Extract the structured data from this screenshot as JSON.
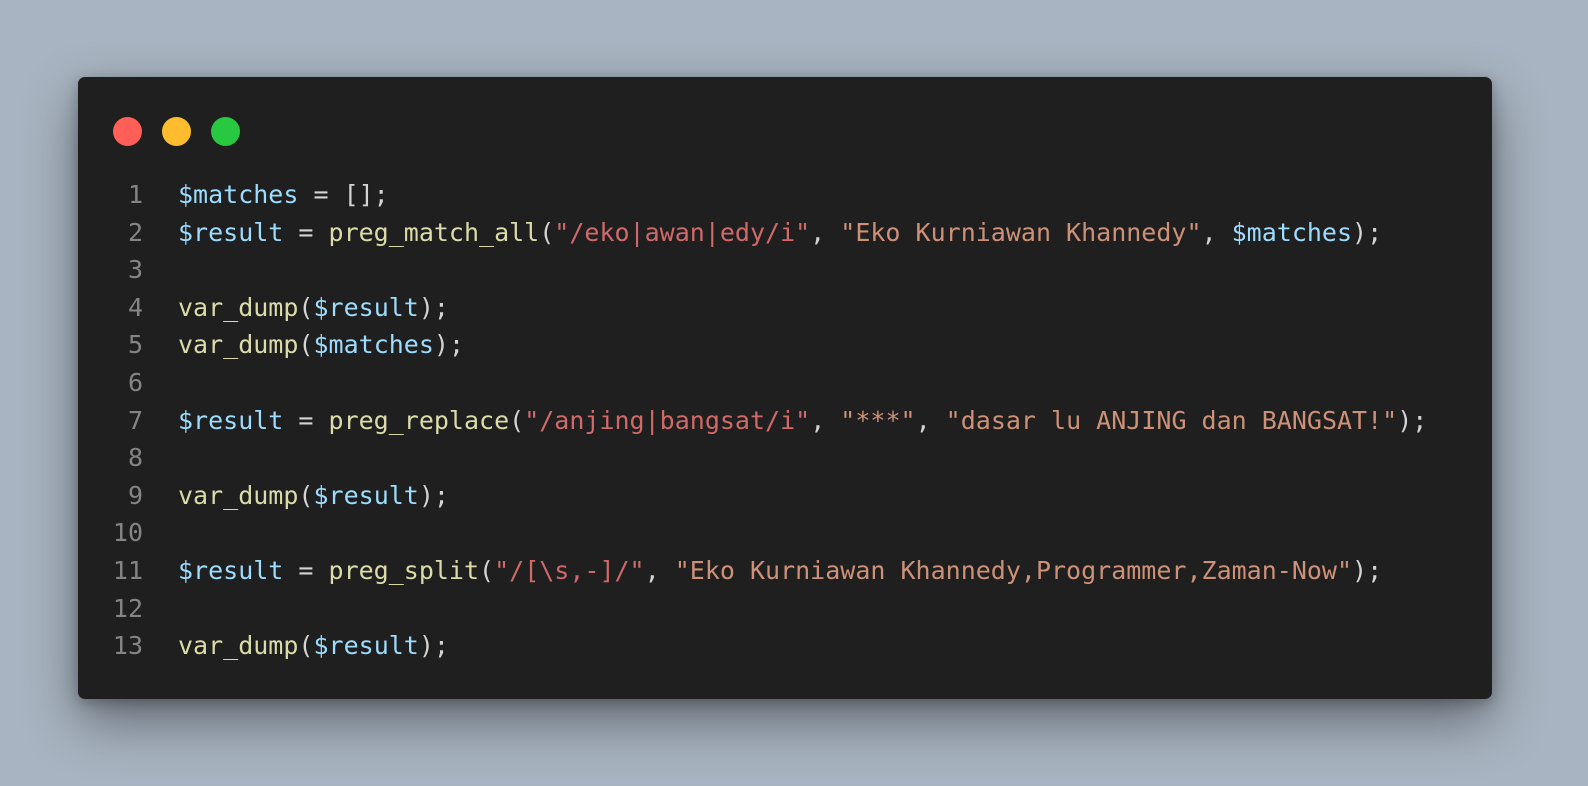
{
  "colors": {
    "background": "#a8b4c1",
    "window": "#1f1f1f",
    "traffic_red": "#ff5f57",
    "traffic_yellow": "#febc2e",
    "traffic_green": "#28c840",
    "line_number": "#858585",
    "variable": "#9cdcfe",
    "function": "#dcdcaa",
    "string": "#ce9178",
    "regex": "#d16969",
    "punctuation": "#d4d4d4"
  },
  "window_controls": [
    {
      "icon": "close-dot-icon",
      "color": "#ff5f57"
    },
    {
      "icon": "minimize-dot-icon",
      "color": "#febc2e"
    },
    {
      "icon": "maximize-dot-icon",
      "color": "#28c840"
    }
  ],
  "lines": [
    {
      "n": "1",
      "tokens": [
        {
          "t": "$matches",
          "c": "#9cdcfe"
        },
        {
          "t": " = [];",
          "c": "#d4d4d4"
        }
      ]
    },
    {
      "n": "2",
      "tokens": [
        {
          "t": "$result",
          "c": "#9cdcfe"
        },
        {
          "t": " = ",
          "c": "#d4d4d4"
        },
        {
          "t": "preg_match_all",
          "c": "#dcdcaa"
        },
        {
          "t": "(",
          "c": "#d4d4d4"
        },
        {
          "t": "\"/eko|awan|edy/i\"",
          "c": "#d16969"
        },
        {
          "t": ", ",
          "c": "#d4d4d4"
        },
        {
          "t": "\"Eko Kurniawan Khannedy\"",
          "c": "#ce9178"
        },
        {
          "t": ", ",
          "c": "#d4d4d4"
        },
        {
          "t": "$matches",
          "c": "#9cdcfe"
        },
        {
          "t": ");",
          "c": "#d4d4d4"
        }
      ]
    },
    {
      "n": "3",
      "tokens": []
    },
    {
      "n": "4",
      "tokens": [
        {
          "t": "var_dump",
          "c": "#dcdcaa"
        },
        {
          "t": "(",
          "c": "#d4d4d4"
        },
        {
          "t": "$result",
          "c": "#9cdcfe"
        },
        {
          "t": ");",
          "c": "#d4d4d4"
        }
      ]
    },
    {
      "n": "5",
      "tokens": [
        {
          "t": "var_dump",
          "c": "#dcdcaa"
        },
        {
          "t": "(",
          "c": "#d4d4d4"
        },
        {
          "t": "$matches",
          "c": "#9cdcfe"
        },
        {
          "t": ");",
          "c": "#d4d4d4"
        }
      ]
    },
    {
      "n": "6",
      "tokens": []
    },
    {
      "n": "7",
      "tokens": [
        {
          "t": "$result",
          "c": "#9cdcfe"
        },
        {
          "t": " = ",
          "c": "#d4d4d4"
        },
        {
          "t": "preg_replace",
          "c": "#dcdcaa"
        },
        {
          "t": "(",
          "c": "#d4d4d4"
        },
        {
          "t": "\"/anjing|bangsat/i\"",
          "c": "#d16969"
        },
        {
          "t": ", ",
          "c": "#d4d4d4"
        },
        {
          "t": "\"***\"",
          "c": "#ce9178"
        },
        {
          "t": ", ",
          "c": "#d4d4d4"
        },
        {
          "t": "\"dasar lu ANJING dan BANGSAT!\"",
          "c": "#ce9178"
        },
        {
          "t": ");",
          "c": "#d4d4d4"
        }
      ]
    },
    {
      "n": "8",
      "tokens": []
    },
    {
      "n": "9",
      "tokens": [
        {
          "t": "var_dump",
          "c": "#dcdcaa"
        },
        {
          "t": "(",
          "c": "#d4d4d4"
        },
        {
          "t": "$result",
          "c": "#9cdcfe"
        },
        {
          "t": ");",
          "c": "#d4d4d4"
        }
      ]
    },
    {
      "n": "10",
      "tokens": []
    },
    {
      "n": "11",
      "tokens": [
        {
          "t": "$result",
          "c": "#9cdcfe"
        },
        {
          "t": " = ",
          "c": "#d4d4d4"
        },
        {
          "t": "preg_split",
          "c": "#dcdcaa"
        },
        {
          "t": "(",
          "c": "#d4d4d4"
        },
        {
          "t": "\"/[\\s,-]/\"",
          "c": "#d16969"
        },
        {
          "t": ", ",
          "c": "#d4d4d4"
        },
        {
          "t": "\"Eko Kurniawan Khannedy,Programmer,Zaman-Now\"",
          "c": "#ce9178"
        },
        {
          "t": ");",
          "c": "#d4d4d4"
        }
      ]
    },
    {
      "n": "12",
      "tokens": []
    },
    {
      "n": "13",
      "tokens": [
        {
          "t": "var_dump",
          "c": "#dcdcaa"
        },
        {
          "t": "(",
          "c": "#d4d4d4"
        },
        {
          "t": "$result",
          "c": "#9cdcfe"
        },
        {
          "t": ");",
          "c": "#d4d4d4"
        }
      ]
    }
  ]
}
